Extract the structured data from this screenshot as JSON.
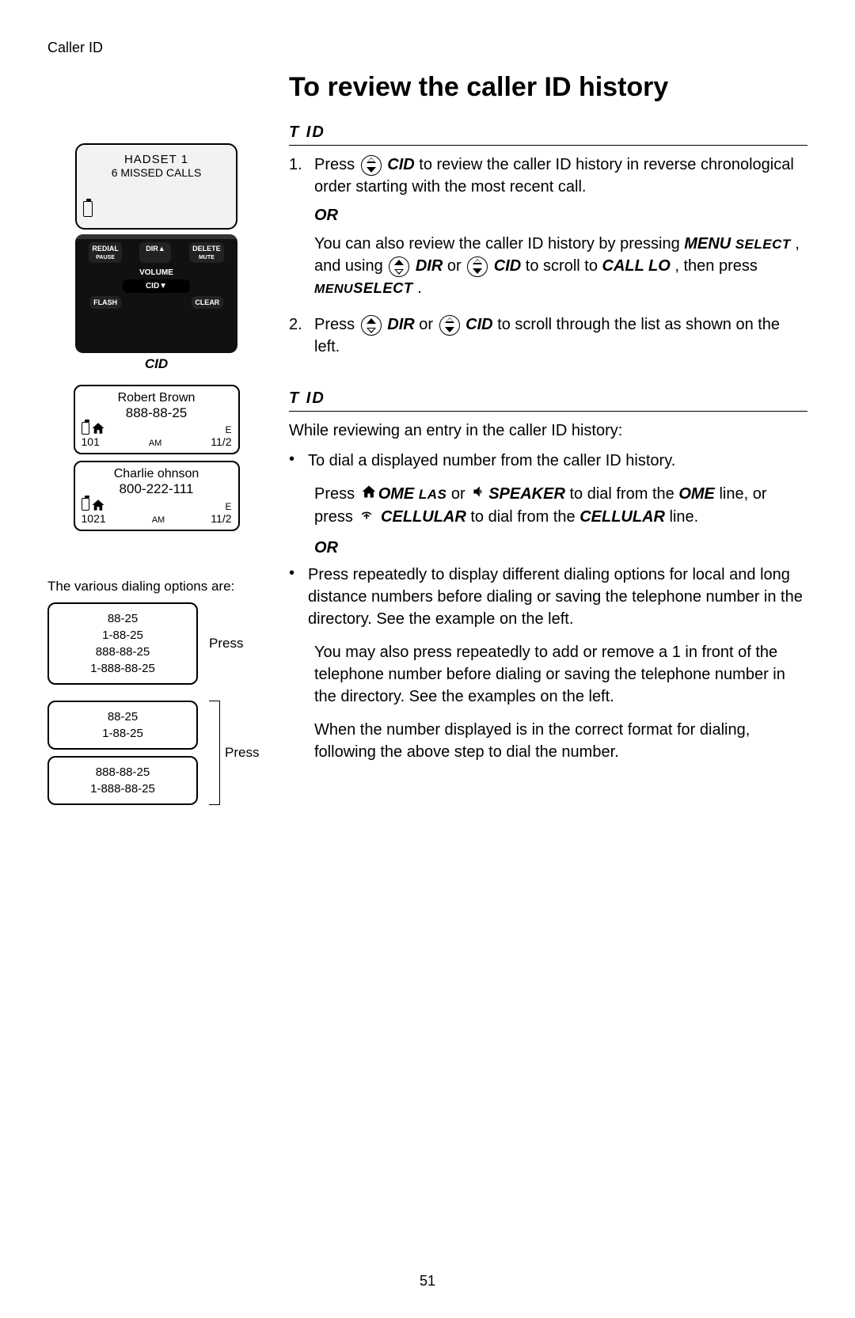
{
  "header": "Caller ID",
  "title": "To review the caller ID history",
  "section1": {
    "heading": "T    ID",
    "step1_a": "Press ",
    "step1_cid": "CID",
    "step1_b": " to review the caller ID history in reverse chronological order starting with the most recent call.",
    "or": "OR",
    "alt_a": "You can also review the caller ID history by pressing ",
    "menu": "MENU",
    "select_sm": "SELECT",
    "alt_b": ", and using ",
    "dir": "DIR",
    "alt_c": " or ",
    "cid": "CID",
    "alt_d": " to scroll to ",
    "call_lo": "CALL LO",
    "alt_e": ", then press ",
    "menuselect": "MENUSELECT",
    "alt_f": ".",
    "step2_a": "Press ",
    "step2_b": " or ",
    "step2_c": " to scroll through the list as shown on the left."
  },
  "section2": {
    "heading": "T    ID",
    "intro": "While reviewing an entry in the caller ID history:",
    "b1": "To dial a displayed number from the caller ID history.",
    "b1_line2_a": "Press ",
    "ome": "OME",
    "las": "LAS",
    "b1_line2_b": " or ",
    "speaker": "SPEAKER",
    "b1_line2_c": " to dial from the ",
    "ome2": "OME",
    "b1_line2_d": " line, or press ",
    "cellular": "CELLULAR",
    "b1_line2_e": " to dial from the ",
    "cellular2": "CELLULAR",
    "b1_line2_f": " line.",
    "or": "OR",
    "b2": "Press    repeatedly to display different dialing options for local and long distance numbers before dialing or saving the telephone number in the directory. See the example on the left.",
    "b2_p2": "You may also press    repeatedly to add or remove a 1 in front of the telephone number before dialing or saving the telephone number in the directory. See the examples on the left.",
    "b2_p3": "When the number displayed is in the correct format for dialing, following the above step to dial the number."
  },
  "left": {
    "screen1": {
      "line1": "HADSET 1",
      "line2": "6 MISSED CALLS"
    },
    "cid_label": "CID",
    "keys": {
      "redial": "REDIAL",
      "pause": "PAUSE",
      "dir": "DIR▲",
      "delete": "DELETE",
      "mute": "MUTE",
      "volume": "VOLUME",
      "cid": "CID▼",
      "flash": "FLASH",
      "clear": "CLEAR"
    },
    "entry1": {
      "name": "Robert Brown",
      "number": "888-88-25",
      "time": "101",
      "ampm": "AM",
      "date": "11/2",
      "tag": "E"
    },
    "entry2": {
      "name": "Charlie ohnson",
      "number": "800-222-111",
      "time": "1021",
      "ampm": "AM",
      "date": "11/2",
      "tag": "E"
    },
    "dial_caption": "The various dialing options are:",
    "press": "Press",
    "box1": [
      "88-25",
      "1-88-25",
      "888-88-25",
      "1-888-88-25"
    ],
    "box2a": [
      "88-25",
      "1-88-25"
    ],
    "box2b": [
      "888-88-25",
      "1-888-88-25"
    ]
  },
  "page_number": "51"
}
